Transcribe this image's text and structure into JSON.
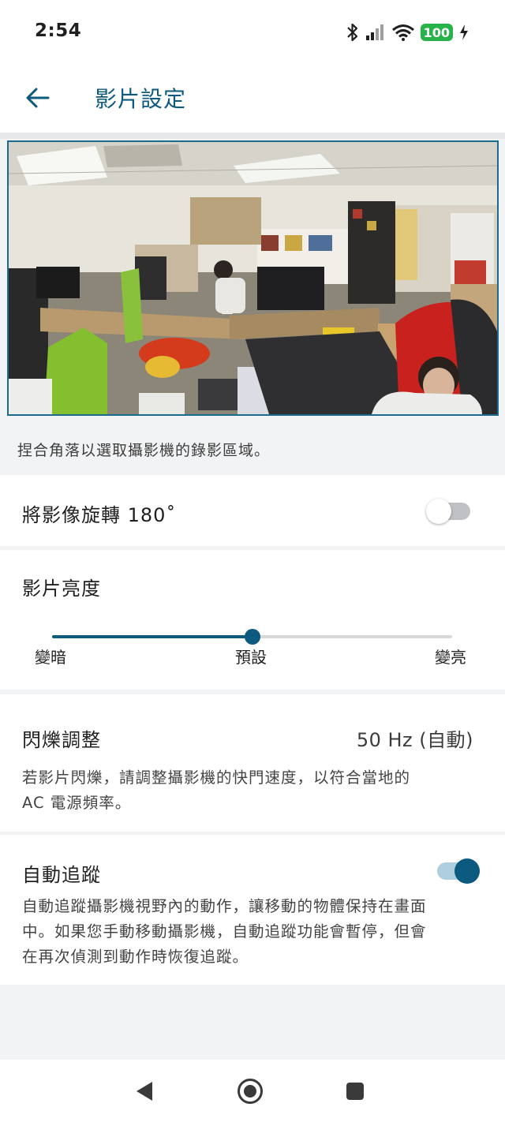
{
  "status_bar": {
    "time": "2:54",
    "battery": "100",
    "icons": [
      "bluetooth-icon",
      "signal-icon",
      "wifi-icon",
      "battery-icon",
      "charging-bolt-icon"
    ]
  },
  "app_bar": {
    "title": "影片設定",
    "back_icon": "arrow-back-icon"
  },
  "preview": {
    "hint": "捏合角落以選取攝影機的錄影區域。"
  },
  "rotate": {
    "label": "將影像旋轉 180˚",
    "enabled": false
  },
  "brightness": {
    "title": "影片亮度",
    "value_fraction": 0.5,
    "labels": {
      "min": "變暗",
      "default": "預設",
      "max": "變亮"
    }
  },
  "flicker": {
    "title": "閃爍調整",
    "value": "50 Hz (自動)",
    "description_line1": "若影片閃爍，請調整攝影機的快門速度，以符合當地的",
    "description_line2": "AC 電源頻率。"
  },
  "auto_tracking": {
    "title": "自動追蹤",
    "enabled": true,
    "description_line1": "自動追蹤攝影機視野內的動作，讓移動的物體保持在畫面",
    "description_line2": "中。如果您手動移動攝影機，自動追蹤功能會暫停，但會",
    "description_line3": "在再次偵測到動作時恢復追蹤。"
  },
  "nav_bar": {
    "icons": [
      "nav-back-icon",
      "nav-home-icon",
      "nav-recents-icon"
    ]
  },
  "colors": {
    "accent": "#0d5a80",
    "title": "#0e5a7e",
    "battery": "#27b24a",
    "background": "#f2f3f5"
  }
}
